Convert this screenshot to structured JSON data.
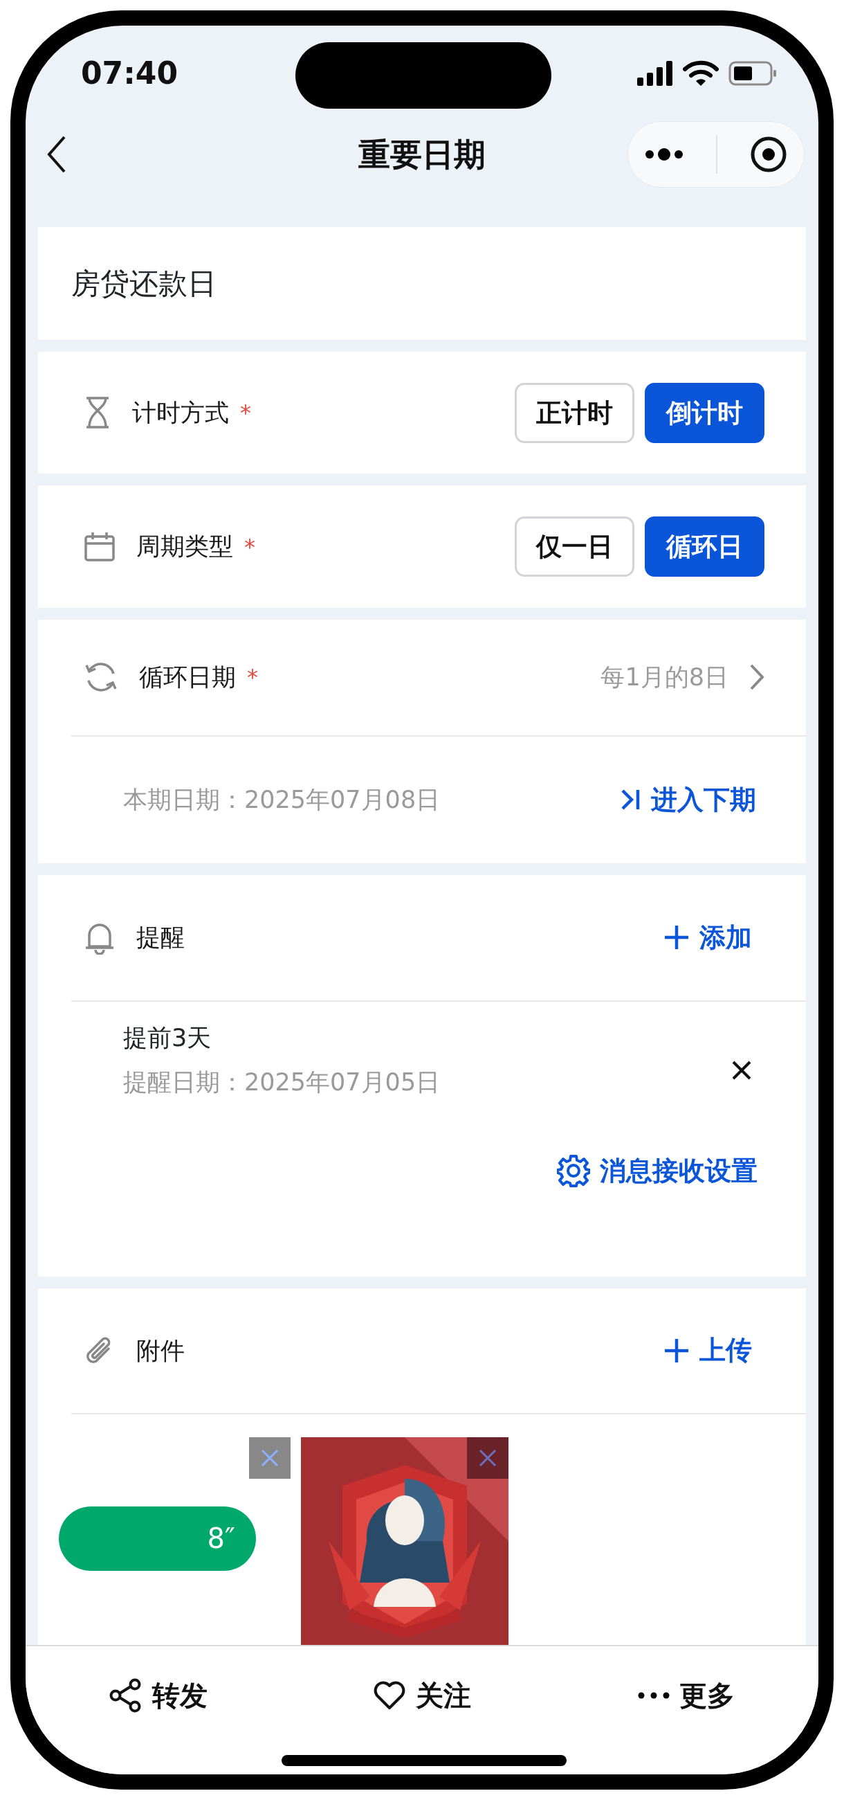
{
  "status_bar": {
    "time": "07:40"
  },
  "nav": {
    "title": "重要日期"
  },
  "event_name": "房贷还款日",
  "timing": {
    "label": "计时方式",
    "mark": "*",
    "options": [
      {
        "label": "正计时",
        "selected": false
      },
      {
        "label": "倒计时",
        "selected": true
      }
    ]
  },
  "cycle_type": {
    "label": "周期类型",
    "mark": "*",
    "options": [
      {
        "label": "仅一日",
        "selected": false
      },
      {
        "label": "循环日",
        "selected": true
      }
    ]
  },
  "cycle_date": {
    "label": "循环日期",
    "mark": "*",
    "value": "每1月的8日",
    "current_period": "本期日期：2025年07月08日",
    "next_button": "进入下期"
  },
  "reminders": {
    "label": "提醒",
    "add_button": "添加",
    "items": [
      {
        "title": "提前3天",
        "date": "提醒日期：2025年07月05日"
      }
    ],
    "settings_link": "消息接收设置"
  },
  "attachments": {
    "label": "附件",
    "upload_button": "上传",
    "voice": {
      "duration": "8″"
    }
  },
  "bottom_bar": [
    {
      "label": "转发"
    },
    {
      "label": "关注"
    },
    {
      "label": "更多"
    }
  ]
}
